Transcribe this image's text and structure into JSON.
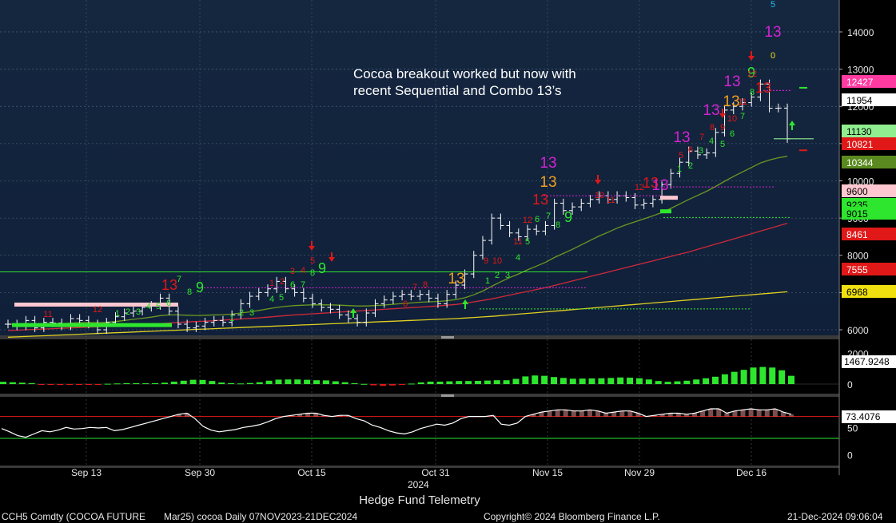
{
  "annotation": {
    "line1": "Cocoa breakout worked but now with",
    "line2": "recent Sequential and Combo 13’s"
  },
  "footer": {
    "title": "Hedge Fund Telemetry",
    "ticker": "CCH5 Comdty (COCOA FUTURE",
    "contract": "Mar25) cocoa  Daily 07NOV2023-21DEC2024",
    "copyright": "Copyright© 2024 Bloomberg Finance L.P.",
    "timestamp": "21-Dec-2024 09:06:04"
  },
  "colors": {
    "background": "#000000",
    "panel_top": "#15263f",
    "panel_bottom": "#10203a",
    "up_count": "#2ee62e",
    "down_count": "#e01818",
    "combo_13": "#d323d3",
    "orange_13": "#f0a020",
    "sma_short": "#6b9a1f",
    "sma_mid": "#d0283a",
    "sma_long": "#e0d020"
  },
  "chart_data": [
    {
      "type": "line",
      "panel": "price",
      "x_ticks": [
        "Sep 13",
        "Sep 30",
        "Oct 15",
        "Oct 31",
        "Nov 15",
        "Nov 29",
        "Dec 16"
      ],
      "x_year_label": "2024",
      "y_ticks": [
        6000,
        7000,
        8000,
        9000,
        10000,
        11000,
        12000,
        13000,
        14000
      ],
      "ylim": [
        5850,
        14600
      ],
      "axis_badges": [
        {
          "value": "12427",
          "bg": "#ff3aa0",
          "fg": "#ffffff"
        },
        {
          "value": "11954",
          "bg": "#ffffff",
          "fg": "#000000"
        },
        {
          "value": "11130",
          "bg": "#90ee90",
          "fg": "#000000"
        },
        {
          "value": "10821",
          "bg": "#e01818",
          "fg": "#ffffff"
        },
        {
          "value": "10344",
          "bg": "#5a8a1f",
          "fg": "#ffffff"
        },
        {
          "value": "9600",
          "bg": "#ffc8d0",
          "fg": "#000000"
        },
        {
          "value": "9235",
          "bg": "#2ee62e",
          "fg": "#000000"
        },
        {
          "value": "9015",
          "bg": "#2ee62e",
          "fg": "#000000"
        },
        {
          "value": "8461",
          "bg": "#e01818",
          "fg": "#ffffff"
        },
        {
          "value": "7555",
          "bg": "#e01818",
          "fg": "#ffffff"
        },
        {
          "value": "6968",
          "bg": "#f0e010",
          "fg": "#000000"
        }
      ],
      "close": [
        6150,
        6100,
        6250,
        6050,
        6200,
        6180,
        6100,
        6300,
        6250,
        6150,
        6000,
        6200,
        6350,
        6450,
        6500,
        6600,
        6650,
        6850,
        6500,
        6150,
        6050,
        6100,
        6200,
        6250,
        6200,
        6400,
        6700,
        6900,
        7000,
        7100,
        7300,
        7100,
        7000,
        6850,
        6700,
        6600,
        6550,
        6400,
        6300,
        6200,
        6450,
        6700,
        6800,
        6900,
        6950,
        6900,
        6950,
        6850,
        6700,
        6950,
        7200,
        7500,
        8000,
        8400,
        9000,
        8800,
        8600,
        8500,
        8700,
        8650,
        8800,
        9400,
        9200,
        9300,
        9400,
        9500,
        9600,
        9500,
        9600,
        9550,
        9350,
        9400,
        9500,
        9900,
        10200,
        10500,
        10800,
        10700,
        10750,
        11300,
        11900,
        12000,
        12100,
        12250,
        12600,
        11950,
        11954,
        11130
      ],
      "series": [
        {
          "name": "sma_short",
          "values": [
            6150,
            6150,
            6160,
            6150,
            6160,
            6170,
            6165,
            6180,
            6190,
            6195,
            6190,
            6200,
            6220,
            6250,
            6280,
            6310,
            6340,
            6380,
            6400,
            6400,
            6390,
            6385,
            6390,
            6400,
            6405,
            6420,
            6450,
            6480,
            6520,
            6560,
            6600,
            6630,
            6650,
            6660,
            6670,
            6670,
            6670,
            6660,
            6650,
            6640,
            6640,
            6650,
            6665,
            6685,
            6705,
            6720,
            6740,
            6750,
            6760,
            6780,
            6810,
            6860,
            6940,
            7040,
            7170,
            7290,
            7400,
            7500,
            7610,
            7710,
            7810,
            7940,
            8050,
            8160,
            8280,
            8400,
            8520,
            8620,
            8730,
            8820,
            8900,
            8980,
            9060,
            9150,
            9260,
            9380,
            9500,
            9610,
            9720,
            9850,
            9990,
            10120,
            10240,
            10360,
            10480,
            10560,
            10620,
            10660
          ]
        },
        {
          "name": "sma_mid",
          "values": [
            5980,
            5990,
            6000,
            6010,
            6020,
            6030,
            6040,
            6050,
            6060,
            6070,
            6080,
            6090,
            6100,
            6110,
            6120,
            6135,
            6150,
            6165,
            6180,
            6195,
            6210,
            6220,
            6230,
            6245,
            6260,
            6275,
            6290,
            6305,
            6320,
            6340,
            6360,
            6380,
            6400,
            6415,
            6430,
            6445,
            6460,
            6475,
            6490,
            6505,
            6520,
            6535,
            6550,
            6565,
            6580,
            6595,
            6610,
            6625,
            6640,
            6660,
            6680,
            6710,
            6750,
            6790,
            6830,
            6880,
            6930,
            6980,
            7030,
            7080,
            7130,
            7190,
            7250,
            7310,
            7370,
            7430,
            7490,
            7550,
            7610,
            7670,
            7730,
            7790,
            7850,
            7910,
            7970,
            8030,
            8090,
            8160,
            8230,
            8300,
            8370,
            8440,
            8510,
            8580,
            8650,
            8720,
            8790,
            8860
          ]
        },
        {
          "name": "sma_long",
          "values": [
            5800,
            5810,
            5820,
            5830,
            5840,
            5850,
            5860,
            5870,
            5880,
            5890,
            5900,
            5910,
            5920,
            5930,
            5940,
            5950,
            5960,
            5970,
            5980,
            5990,
            6000,
            6010,
            6020,
            6030,
            6040,
            6050,
            6060,
            6070,
            6080,
            6090,
            6100,
            6110,
            6120,
            6130,
            6140,
            6150,
            6160,
            6170,
            6180,
            6190,
            6200,
            6210,
            6220,
            6230,
            6240,
            6250,
            6260,
            6270,
            6280,
            6290,
            6300,
            6315,
            6330,
            6345,
            6360,
            6380,
            6400,
            6420,
            6440,
            6460,
            6480,
            6500,
            6520,
            6540,
            6560,
            6580,
            6600,
            6620,
            6640,
            6660,
            6680,
            6700,
            6720,
            6740,
            6760,
            6780,
            6800,
            6820,
            6840,
            6860,
            6880,
            6900,
            6920,
            6940,
            6960,
            6980,
            7000,
            7020
          ]
        }
      ],
      "count_labels": [
        {
          "text": "11",
          "color": "down"
        },
        {
          "text": "12",
          "color": "down"
        },
        {
          "text": "1",
          "color": "up"
        },
        {
          "text": "2",
          "color": "up"
        },
        {
          "text": "3",
          "color": "up"
        },
        {
          "text": "4",
          "color": "up"
        },
        {
          "text": "5",
          "color": "up"
        },
        {
          "text": "6",
          "color": "up"
        },
        {
          "text": "7",
          "color": "up"
        },
        {
          "text": "8",
          "color": "up"
        },
        {
          "text": "9",
          "color": "up"
        },
        {
          "text": "13",
          "color": "down"
        },
        {
          "text": "1",
          "color": "up"
        },
        {
          "text": "2",
          "color": "up"
        },
        {
          "text": "3",
          "color": "up"
        },
        {
          "text": "4",
          "color": "up"
        },
        {
          "text": "5",
          "color": "up"
        },
        {
          "text": "6",
          "color": "up"
        },
        {
          "text": "7",
          "color": "up"
        },
        {
          "text": "8",
          "color": "up"
        },
        {
          "text": "9",
          "color": "up"
        },
        {
          "text": "1",
          "color": "down"
        },
        {
          "text": "2",
          "color": "down"
        },
        {
          "text": "3",
          "color": "down"
        },
        {
          "text": "4",
          "color": "down"
        },
        {
          "text": "5",
          "color": "down"
        },
        {
          "text": "6",
          "color": "down"
        },
        {
          "text": "7",
          "color": "down"
        },
        {
          "text": "8",
          "color": "down"
        },
        {
          "text": "13",
          "color": "orange"
        },
        {
          "text": "1",
          "color": "up"
        },
        {
          "text": "2",
          "color": "up"
        },
        {
          "text": "3",
          "color": "up"
        },
        {
          "text": "9",
          "color": "down"
        },
        {
          "text": "10",
          "color": "down"
        },
        {
          "text": "4",
          "color": "up"
        },
        {
          "text": "5",
          "color": "up"
        },
        {
          "text": "6",
          "color": "up"
        },
        {
          "text": "7",
          "color": "up"
        },
        {
          "text": "8",
          "color": "up"
        },
        {
          "text": "9",
          "color": "up"
        },
        {
          "text": "11",
          "color": "down"
        },
        {
          "text": "12",
          "color": "down"
        },
        {
          "text": "13",
          "color": "down"
        },
        {
          "text": "13",
          "color": "orange"
        },
        {
          "text": "13",
          "color": "combo"
        },
        {
          "text": "10",
          "color": "down"
        },
        {
          "text": "11",
          "color": "down"
        },
        {
          "text": "12",
          "color": "down"
        },
        {
          "text": "13",
          "color": "down"
        },
        {
          "text": "13",
          "color": "combo"
        },
        {
          "text": "1",
          "color": "up"
        },
        {
          "text": "2",
          "color": "up"
        },
        {
          "text": "3",
          "color": "up"
        },
        {
          "text": "4",
          "color": "up"
        },
        {
          "text": "5",
          "color": "up"
        },
        {
          "text": "6",
          "color": "up"
        },
        {
          "text": "7",
          "color": "up"
        },
        {
          "text": "8",
          "color": "up"
        },
        {
          "text": "9",
          "color": "up"
        },
        {
          "text": "5",
          "color": "down"
        },
        {
          "text": "6",
          "color": "down"
        },
        {
          "text": "7",
          "color": "down"
        },
        {
          "text": "8",
          "color": "down"
        },
        {
          "text": "9",
          "color": "down"
        },
        {
          "text": "10",
          "color": "down"
        },
        {
          "text": "11",
          "color": "down"
        },
        {
          "text": "12",
          "color": "down"
        },
        {
          "text": "13",
          "color": "down"
        },
        {
          "text": "13",
          "color": "combo"
        },
        {
          "text": "13",
          "color": "orange"
        },
        {
          "text": "13",
          "color": "combo"
        },
        {
          "text": "13",
          "color": "combo"
        },
        {
          "text": "13",
          "color": "combo"
        },
        {
          "text": "0",
          "color": "yellow"
        },
        {
          "text": "5",
          "color": "cyan"
        }
      ]
    },
    {
      "type": "bar",
      "panel": "momentum",
      "y_ticks": [
        0,
        2000
      ],
      "ylim": [
        -400,
        2400
      ],
      "last_value": "1467.9248",
      "values": [
        150,
        120,
        90,
        60,
        -40,
        -50,
        -60,
        -50,
        -40,
        -30,
        -20,
        20,
        40,
        60,
        60,
        50,
        60,
        90,
        160,
        220,
        280,
        270,
        200,
        100,
        60,
        40,
        70,
        120,
        220,
        290,
        300,
        300,
        280,
        250,
        240,
        180,
        120,
        60,
        10,
        -80,
        -120,
        -90,
        -40,
        30,
        110,
        160,
        160,
        180,
        200,
        200,
        210,
        230,
        250,
        250,
        340,
        500,
        560,
        540,
        460,
        400,
        350,
        360,
        370,
        380,
        400,
        430,
        420,
        380,
        300,
        200,
        150,
        180,
        220,
        300,
        380,
        480,
        640,
        800,
        930,
        1080,
        1120,
        1080,
        900,
        540
      ]
    },
    {
      "type": "line",
      "panel": "oscillator",
      "y_ticks": [
        0,
        50
      ],
      "ylim": [
        -5,
        100
      ],
      "reference_lines": [
        70,
        30
      ],
      "last_value": "73.4076",
      "values": [
        48,
        42,
        35,
        32,
        38,
        44,
        42,
        45,
        50,
        47,
        48,
        50,
        49,
        50,
        44,
        46,
        50,
        54,
        58,
        62,
        66,
        70,
        74,
        76,
        66,
        52,
        45,
        42,
        44,
        46,
        50,
        52,
        55,
        60,
        66,
        70,
        72,
        74,
        76,
        76,
        72,
        70,
        72,
        72,
        66,
        62,
        54,
        50,
        44,
        40,
        38,
        42,
        48,
        52,
        56,
        54,
        58,
        66,
        70,
        70,
        70,
        72,
        56,
        54,
        58,
        70,
        74,
        78,
        80,
        82,
        82,
        80,
        80,
        82,
        80,
        76,
        78,
        80,
        80,
        76,
        70,
        72,
        74,
        76,
        76,
        74,
        76,
        80,
        84,
        84,
        76,
        80,
        82,
        84,
        82,
        82,
        84,
        78,
        74
      ]
    }
  ]
}
